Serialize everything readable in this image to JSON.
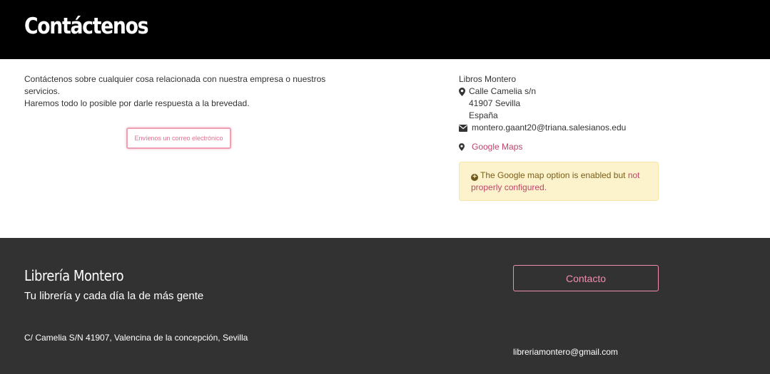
{
  "header": {
    "title": "Contáctenos"
  },
  "intro": {
    "line1": "Contáctenos sobre cualquier cosa relacionada con nuestra empresa o nuestros servicios.",
    "line2": "Haremos todo lo posible por darle respuesta a la brevedad."
  },
  "email_button": {
    "label": "Envíenos un correo electrónico"
  },
  "contact": {
    "company": "Libros Montero",
    "street": "Calle Camelia s/n",
    "postal_city": "41907 Sevilla",
    "country": "España",
    "email": "montero.gaant20@triana.salesianos.edu",
    "maps_label": "Google Maps",
    "icons": [
      "map-marker-icon",
      "envelope-icon",
      "map-marker-icon"
    ]
  },
  "alert": {
    "text": "The Google map option is enabled but ",
    "link": "not properly configured."
  },
  "footer": {
    "title": "Librería Montero",
    "tagline": "Tu librería y cada día la de más gente",
    "address": "C/ Camelia S/N 41907, Valencina de la concepción, Sevilla",
    "contact_button": "Contacto",
    "email": "libreriamontero@gmail.com"
  },
  "colors": {
    "header_bg": "#000000",
    "footer_bg": "#333232",
    "accent_pink": "#f08fad",
    "link_pink": "#c0446a",
    "alert_bg": "#fcf2cc"
  }
}
